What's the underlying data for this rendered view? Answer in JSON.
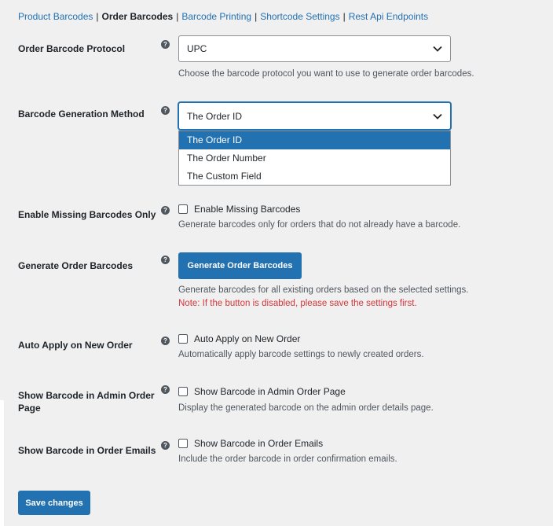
{
  "subnav": {
    "items": [
      "Product Barcodes",
      "Order Barcodes",
      "Barcode Printing",
      "Shortcode Settings",
      "Rest Api Endpoints"
    ],
    "separator": "|"
  },
  "help_glyph": "?",
  "protocol": {
    "label": "Order Barcode Protocol",
    "value": "UPC",
    "description": "Choose the barcode protocol you want to use to generate order barcodes."
  },
  "generation": {
    "label": "Barcode Generation Method",
    "value": "The Order ID",
    "options": [
      "The Order ID",
      "The Order Number",
      "The Custom Field"
    ]
  },
  "missing": {
    "label": "Enable Missing Barcodes Only",
    "checkbox_label": "Enable Missing Barcodes",
    "description": "Generate barcodes only for orders that do not already have a barcode."
  },
  "generate": {
    "label": "Generate Order Barcodes",
    "button": "Generate Order Barcodes",
    "description": "Generate barcodes for all existing orders based on the selected settings.",
    "note": "Note: If the button is disabled, please save the settings first."
  },
  "auto_apply": {
    "label": "Auto Apply on New Order",
    "checkbox_label": "Auto Apply on New Order",
    "description": "Automatically apply barcode settings to newly created orders."
  },
  "admin_page": {
    "label_line1": "Show Barcode in Admin Order",
    "label_line2": "Page",
    "checkbox_label": "Show Barcode in Admin Order Page",
    "description": "Display the generated barcode on the admin order details page."
  },
  "emails": {
    "label": "Show Barcode in Order Emails",
    "checkbox_label": "Show Barcode in Order Emails",
    "description": "Include the order barcode in order confirmation emails."
  },
  "save_button": "Save changes",
  "colors": {
    "primary": "#2271b1",
    "link": "#2271b1",
    "note": "#d63638",
    "background": "#f0f0f1"
  }
}
